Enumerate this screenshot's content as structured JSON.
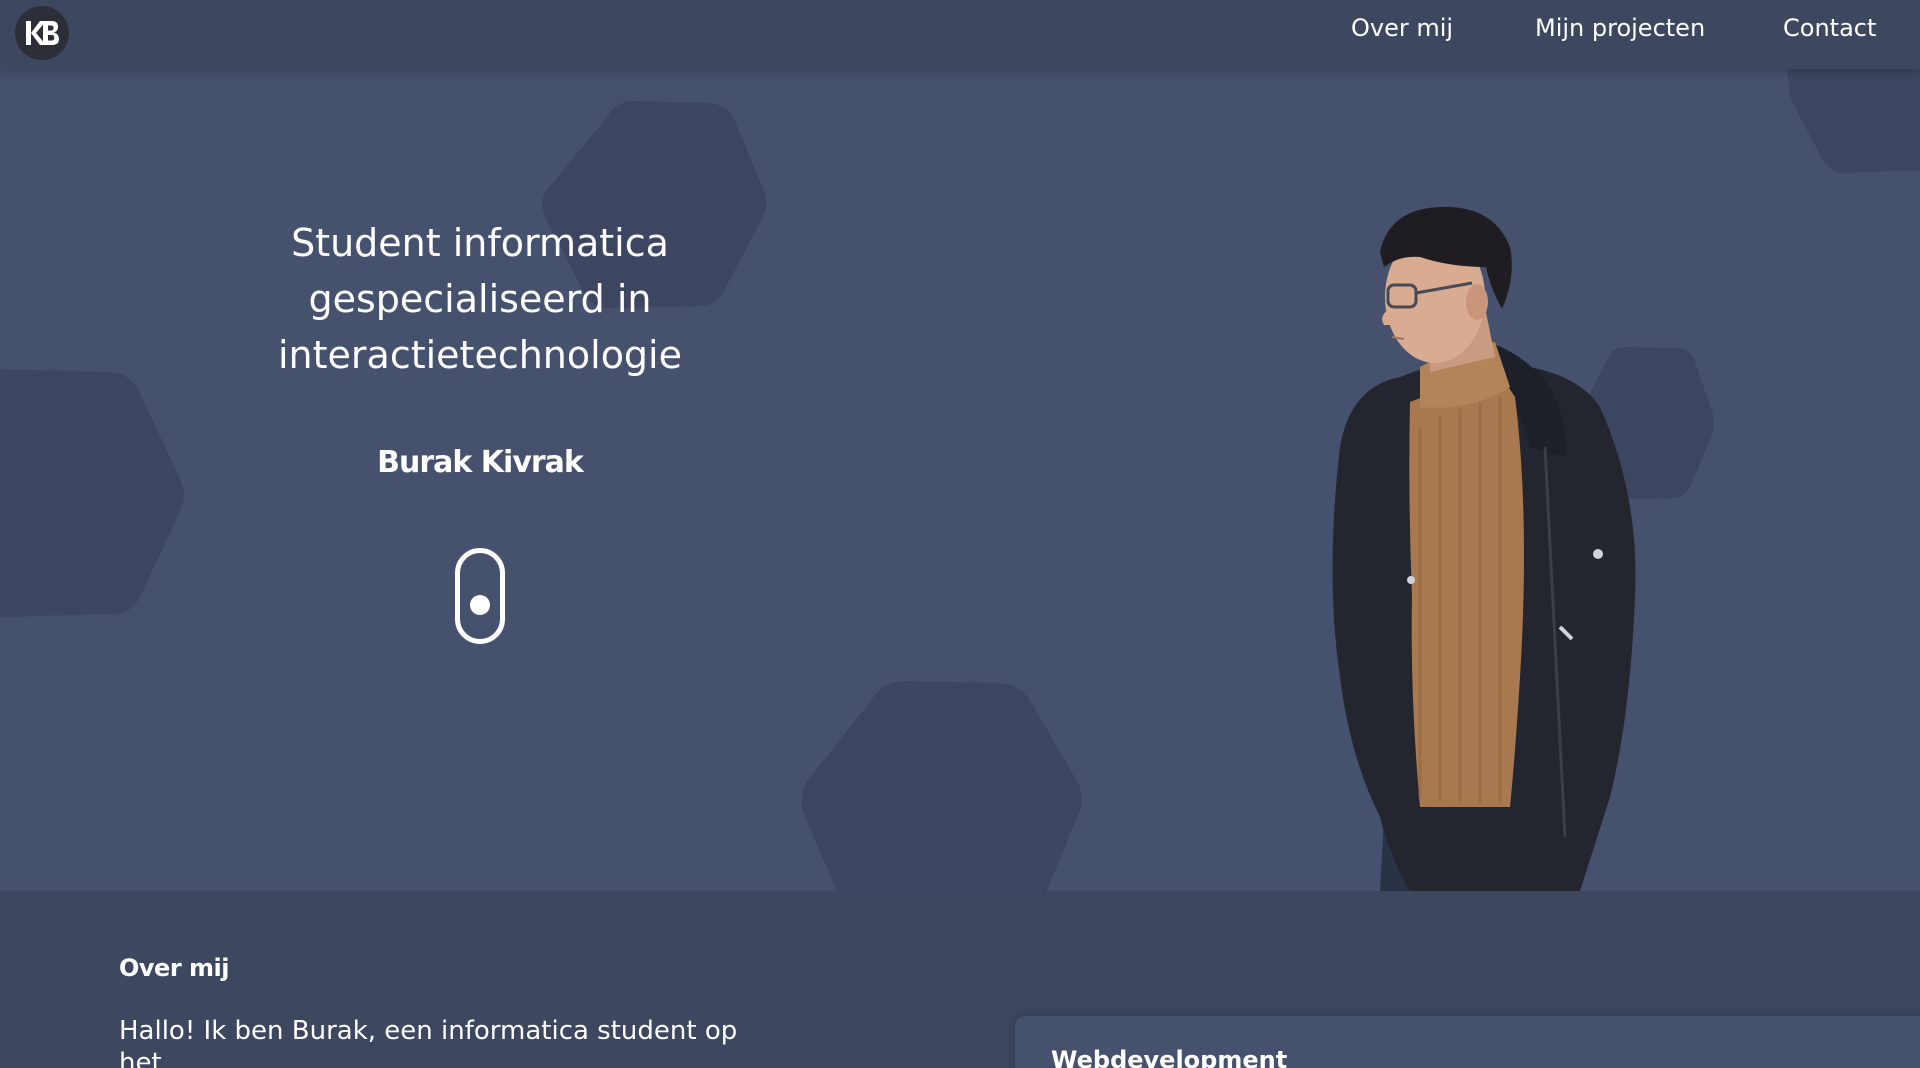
{
  "header": {
    "logo_icon": "kb-logo-icon",
    "nav": {
      "about": "Over mij",
      "projects": "Mijn projecten",
      "contact": "Contact"
    }
  },
  "hero": {
    "title": "Student informatica gespecialiseerd in interactietechnologie",
    "name": "Burak Kivrak",
    "scroll_icon": "mouse-scroll-icon",
    "portrait_icon": "portrait-photo"
  },
  "about": {
    "heading": "Over mij",
    "intro": "Hallo! Ik ben Burak, een informatica student op het",
    "card_title": "Webdevelopment"
  },
  "colors": {
    "background": "#45516d",
    "header": "#3d4760",
    "section": "#3d4760",
    "hexagon": "#3d4660",
    "text": "#ffffff"
  }
}
